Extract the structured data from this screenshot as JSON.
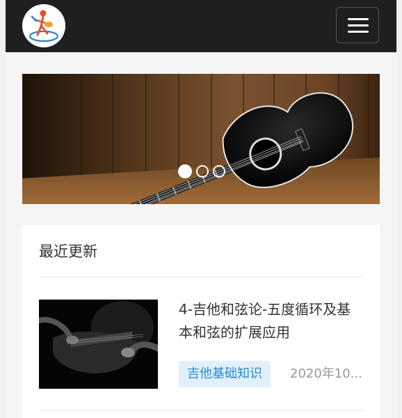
{
  "header": {
    "logo_icon": "guitar-player-logo-icon",
    "menu_icon": "hamburger-menu-icon"
  },
  "banner": {
    "image": "acoustic-guitar-on-wood-photo",
    "slides": 3,
    "active_slide": 1
  },
  "recent": {
    "section_title": "最近更新",
    "posts": [
      {
        "title": "4-吉他和弦论-五度循环及基本和弦的扩展应用",
        "category": "吉他基础知识",
        "date": "2020年10..."
      }
    ]
  },
  "colors": {
    "header_bg": "#1f1f1f",
    "tag_bg": "#e3f0fb",
    "tag_text": "#1b8bd6"
  }
}
